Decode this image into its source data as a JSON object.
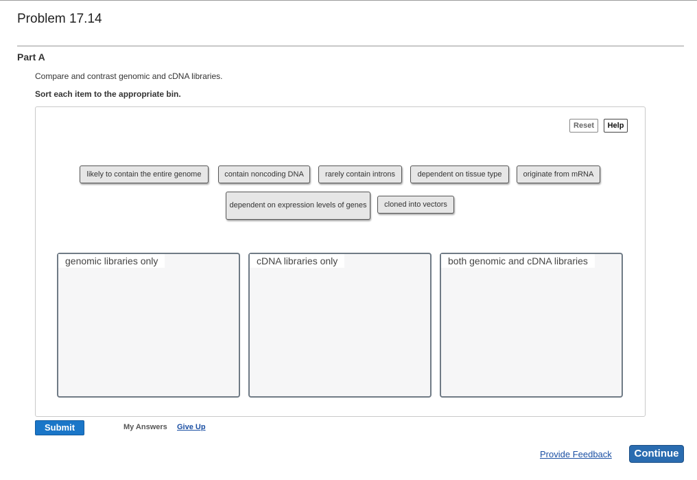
{
  "problem_title": "Problem 17.14",
  "part_label": "Part A",
  "question": "Compare and contrast genomic and cDNA libraries.",
  "instruction": "Sort each item to the appropriate bin.",
  "toolbar": {
    "reset_label": "Reset",
    "help_label": "Help"
  },
  "items": [
    "likely to contain the entire genome",
    "contain noncoding DNA",
    "rarely contain introns",
    "dependent on tissue type",
    "originate from mRNA",
    "dependent on expression levels of genes",
    "cloned into vectors"
  ],
  "bins": [
    "genomic libraries only",
    "cDNA libraries only",
    "both genomic and cDNA libraries"
  ],
  "footer": {
    "submit_label": "Submit",
    "my_answers_label": "My Answers",
    "give_up_label": "Give Up",
    "feedback_label": "Provide Feedback",
    "continue_label": "Continue"
  },
  "colors": {
    "accent": "#1a76c8",
    "link": "#1a4fa3",
    "continue": "#2a6cb0"
  }
}
